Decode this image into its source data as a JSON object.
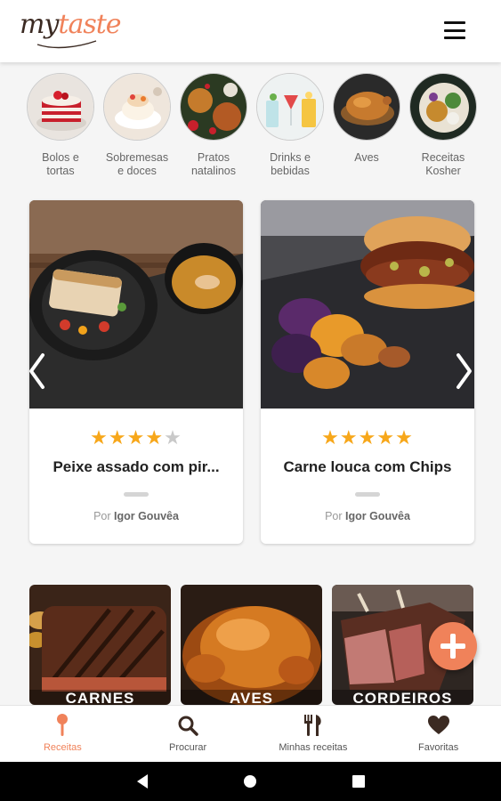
{
  "app": {
    "logo_part1": "my",
    "logo_part2": "taste",
    "brand_color": "#f0825a",
    "menu_icon": "hamburger-menu-icon"
  },
  "categories": [
    {
      "label": "Bolos e tortas",
      "image": "red-velvet-cake"
    },
    {
      "label": "Sobremesas e doces",
      "image": "pavlova-dessert"
    },
    {
      "label": "Pratos natalinos",
      "image": "christmas-dishes"
    },
    {
      "label": "Drinks e bebidas",
      "image": "cocktail-glasses"
    },
    {
      "label": "Aves",
      "image": "roast-chicken"
    },
    {
      "label": "Receitas Kosher",
      "image": "kosher-bowl"
    }
  ],
  "featured": [
    {
      "title": "Peixe assado com pir...",
      "rating": 4,
      "max_rating": 5,
      "by_prefix": "Por",
      "author": "Igor Gouvêa",
      "image": "baked-fish-plate"
    },
    {
      "title": "Carne louca com Chips",
      "rating": 5,
      "max_rating": 5,
      "by_prefix": "Por",
      "author": "Igor Gouvêa",
      "image": "shredded-beef-sandwich-chips"
    }
  ],
  "tiles": [
    {
      "label": "CARNES",
      "image": "grilled-steak"
    },
    {
      "label": "AVES",
      "image": "roast-chicken"
    },
    {
      "label": "CORDEIROS",
      "image": "lamb-rack"
    }
  ],
  "fab": {
    "icon": "plus-icon"
  },
  "nav": [
    {
      "label": "Receitas",
      "icon": "spoon-icon",
      "active": true
    },
    {
      "label": "Procurar",
      "icon": "search-icon",
      "active": false
    },
    {
      "label": "Minhas receitas",
      "icon": "utensils-icon",
      "active": false
    },
    {
      "label": "Favoritas",
      "icon": "heart-icon",
      "active": false
    }
  ],
  "system_bar": [
    "back-icon",
    "home-icon",
    "recents-icon"
  ]
}
